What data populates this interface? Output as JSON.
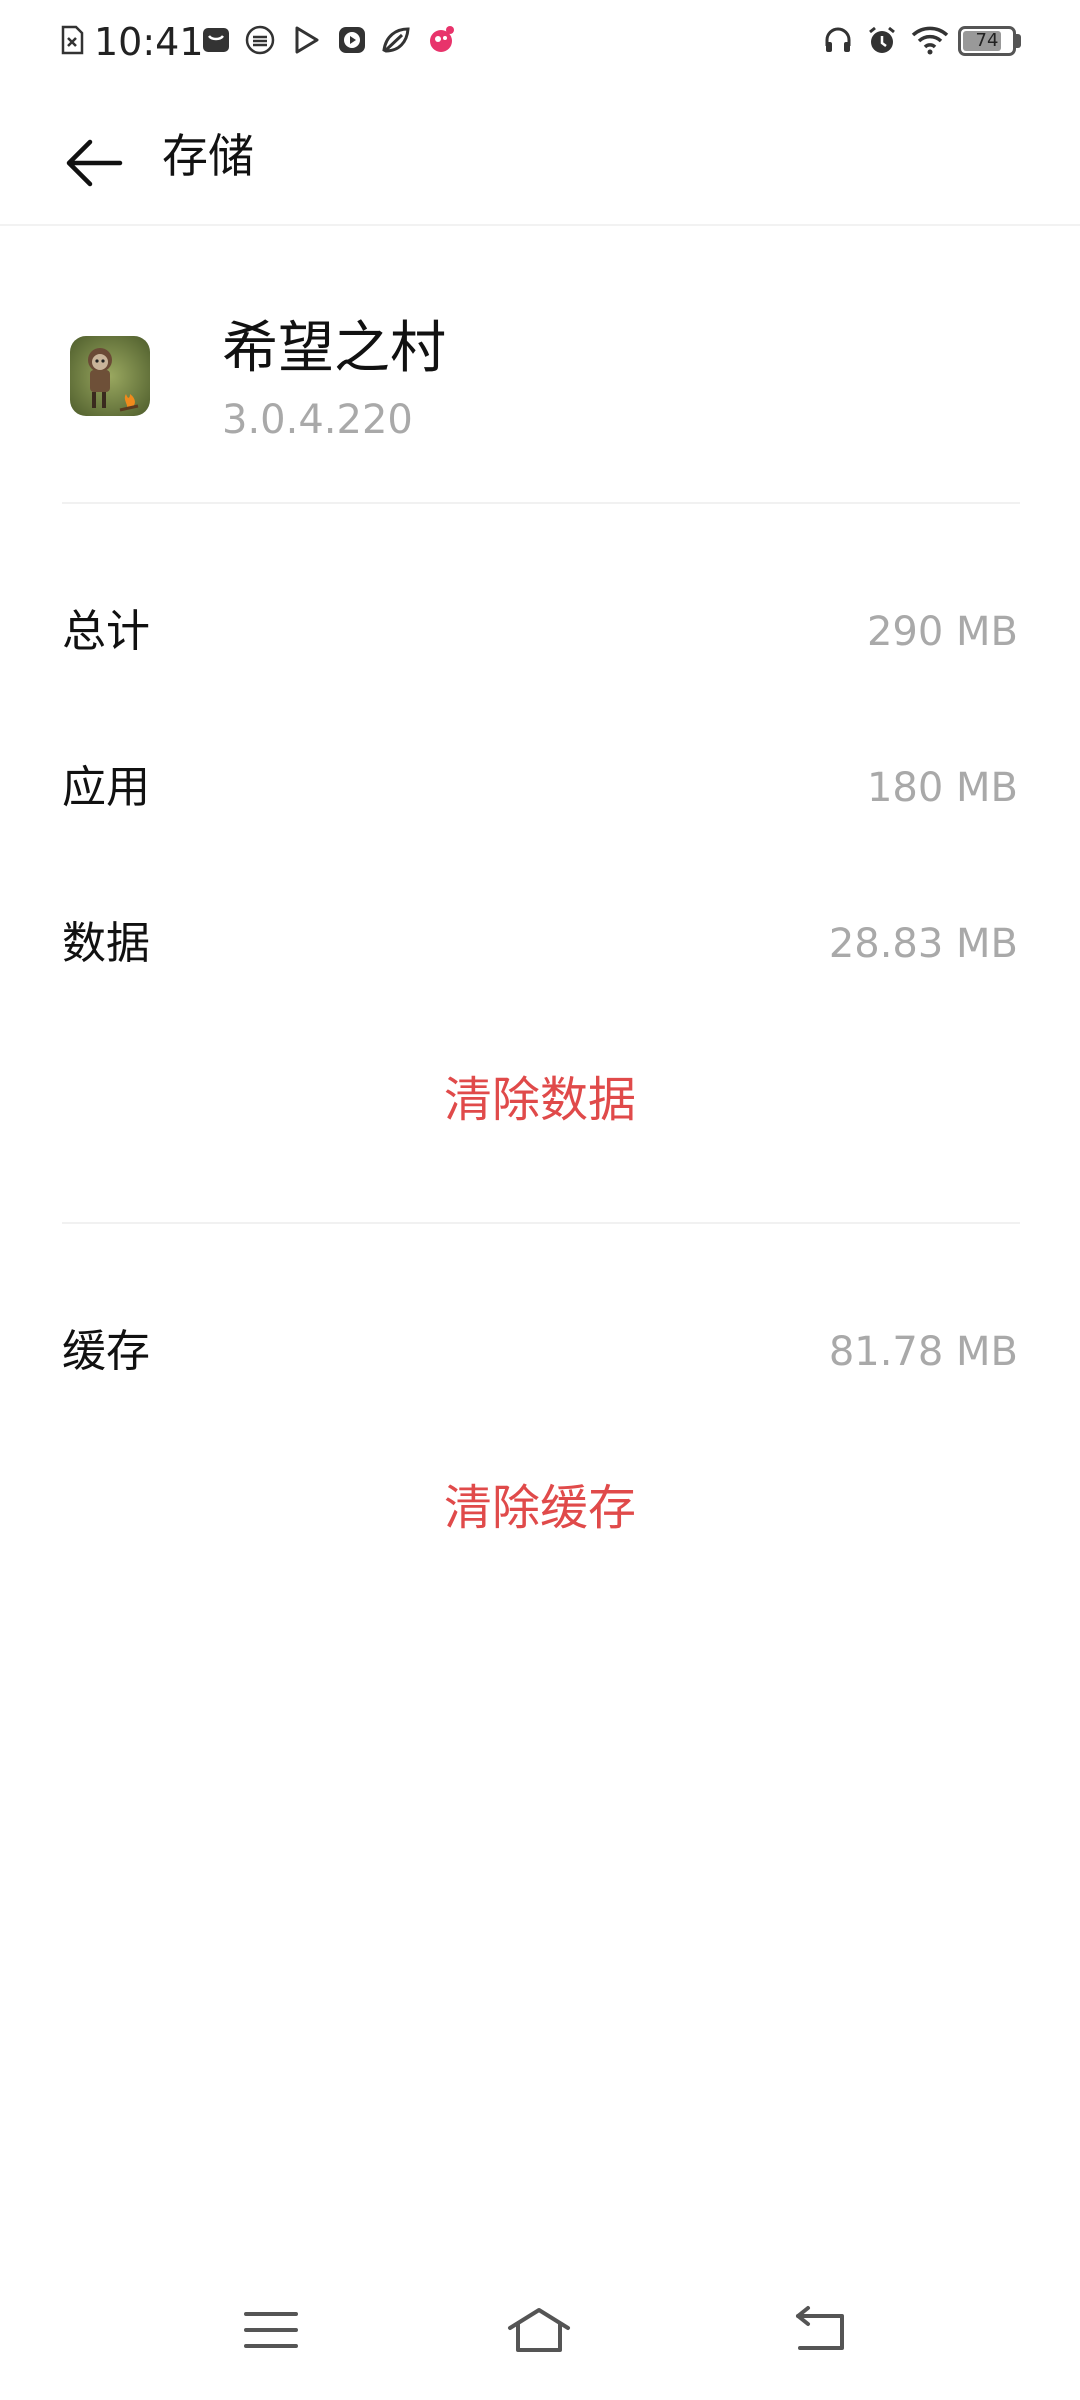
{
  "status_bar": {
    "time": "10:41",
    "battery": "74",
    "icons": [
      "sim-error-icon",
      "wallet-icon",
      "app-icon",
      "video-icon",
      "play-icon",
      "leaf-icon",
      "notification-icon",
      "headphones-icon",
      "alarm-icon",
      "wifi-icon"
    ]
  },
  "header": {
    "title": "存储"
  },
  "app": {
    "name": "希望之村",
    "version": "3.0.4.220"
  },
  "storage": {
    "rows": [
      {
        "label": "总计",
        "value": "290 MB"
      },
      {
        "label": "应用",
        "value": "180 MB"
      },
      {
        "label": "数据",
        "value": "28.83 MB"
      }
    ],
    "clear_data": "清除数据",
    "cache": {
      "label": "缓存",
      "value": "81.78 MB"
    },
    "clear_cache": "清除缓存"
  },
  "nav": {
    "icons": [
      "menu-icon",
      "home-icon",
      "back-nav-icon"
    ]
  },
  "colors": {
    "accent": "#e04a4a",
    "secondary_text": "#a9a9a9"
  }
}
